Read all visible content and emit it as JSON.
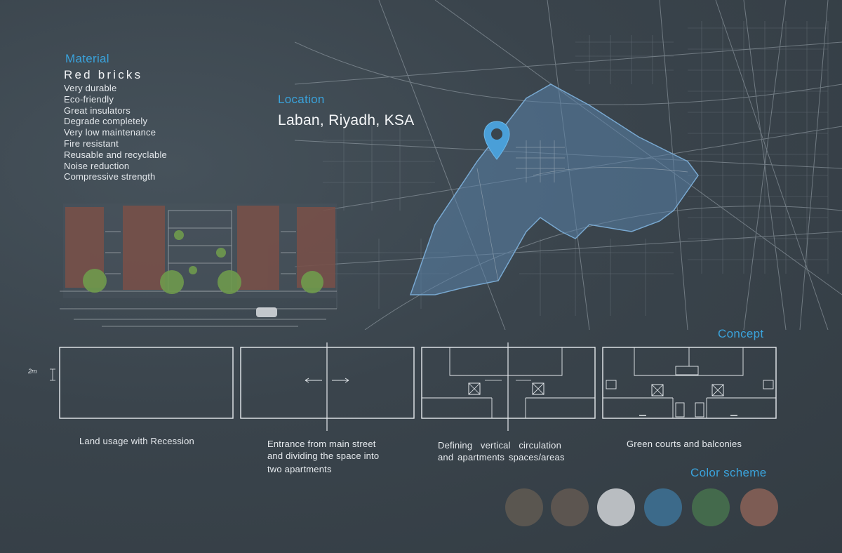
{
  "material": {
    "heading": "Material",
    "title": "Red bricks",
    "items": [
      "Very durable",
      "Eco-friendly",
      "Great insulators",
      "Degrade completely",
      "Very low maintenance",
      "Fire resistant",
      "Reusable and recyclable",
      "Noise reduction",
      "Compressive strength"
    ]
  },
  "location": {
    "heading": "Location",
    "value": "Laban, Riyadh, KSA"
  },
  "concept": {
    "heading": "Concept",
    "dimension_label": "2m",
    "steps": [
      {
        "caption": "Land usage with Recession"
      },
      {
        "caption_lines": [
          "Entrance from main street",
          "and dividing the space into",
          "two apartments"
        ]
      },
      {
        "caption_lines": [
          "Defining  vertical  circulation",
          "and apartments spaces/areas"
        ]
      },
      {
        "caption": "Green courts and balconies"
      }
    ]
  },
  "color_scheme": {
    "heading": "Color scheme",
    "swatches": [
      "#5a5650",
      "#5c5550",
      "#b9bdc1",
      "#3c6a8a",
      "#446a4c",
      "#7d5c54"
    ]
  },
  "colors": {
    "accent": "#3aa3dc",
    "background": "#3a444c",
    "map_highlight": "#5c89b2"
  },
  "icons": [
    "location-pin-icon"
  ]
}
